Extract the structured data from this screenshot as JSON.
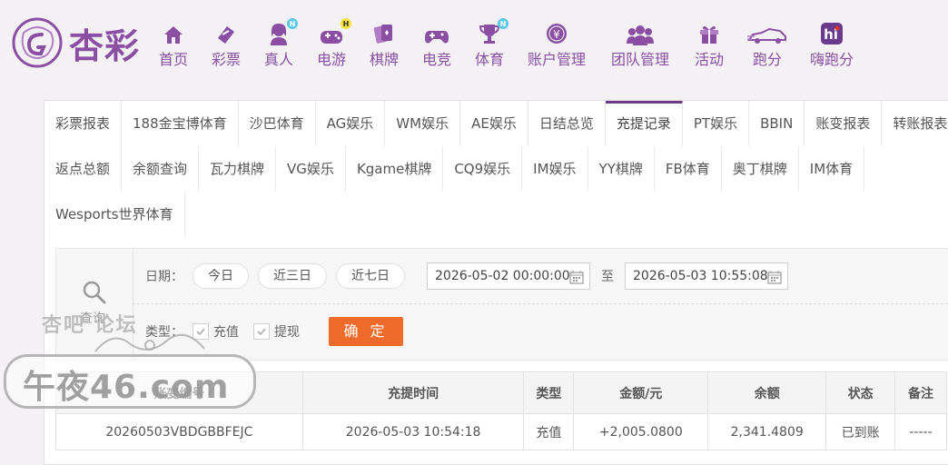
{
  "brand": {
    "logo_text": "杏彩",
    "accent": "#8a4fa3",
    "cta": "#f06a2a"
  },
  "nav": [
    {
      "label": "首页",
      "icon": "home-icon"
    },
    {
      "label": "彩票",
      "icon": "lottery-ticket-icon"
    },
    {
      "label": "真人",
      "icon": "live-dealer-icon",
      "badge": "N"
    },
    {
      "label": "电游",
      "icon": "gamepad-icon",
      "badge": "H"
    },
    {
      "label": "棋牌",
      "icon": "cards-icon"
    },
    {
      "label": "电竞",
      "icon": "esports-controller-icon"
    },
    {
      "label": "体育",
      "icon": "trophy-icon",
      "badge": "N"
    },
    {
      "label": "账户管理",
      "icon": "yen-coin-icon"
    },
    {
      "label": "团队管理",
      "icon": "team-icon"
    },
    {
      "label": "活动",
      "icon": "gift-icon"
    },
    {
      "label": "跑分",
      "icon": "car-icon"
    },
    {
      "label": "嗨跑分",
      "icon": "hi-app-icon"
    }
  ],
  "tabs": {
    "row1": [
      "彩票报表",
      "188金宝博体育",
      "沙巴体育",
      "AG娱乐",
      "WM娱乐",
      "AE娱乐",
      "日结总览",
      "充提记录",
      "PT娱乐",
      "BBIN",
      "账变报表",
      "转账报表"
    ],
    "row2": [
      "返点总额",
      "余额查询",
      "瓦力棋牌",
      "VG娱乐",
      "Kgame棋牌",
      "CQ9娱乐",
      "IM娱乐",
      "YY棋牌",
      "FB体育",
      "奥丁棋牌",
      "IM体育"
    ],
    "row3": [
      "Wesports世界体育"
    ],
    "active": "充提记录"
  },
  "filter": {
    "query_label": "查询",
    "date_label": "日期：",
    "quick_ranges": [
      "今日",
      "近三日",
      "近七日"
    ],
    "start": "2026-05-02 00:00:00",
    "to_label": "至",
    "end": "2026-05-03 10:55:08",
    "type_label": "类型：",
    "types": [
      {
        "label": "充值",
        "checked": true
      },
      {
        "label": "提现",
        "checked": true
      }
    ],
    "confirm": "确 定"
  },
  "table": {
    "columns": [
      "账变编号",
      "充提时间",
      "类型",
      "金额/元",
      "余额",
      "状态",
      "备注"
    ],
    "rows": [
      {
        "id": "20260503VBDGBBFEJC",
        "time": "2026-05-03 10:54:18",
        "type": "充值",
        "amount": "+2,005.0800",
        "balance": "2,341.4809",
        "status": "已到账",
        "remark": "-----"
      }
    ]
  },
  "watermark": {
    "top": "杏吧   论坛",
    "main": "午夜46.com"
  }
}
